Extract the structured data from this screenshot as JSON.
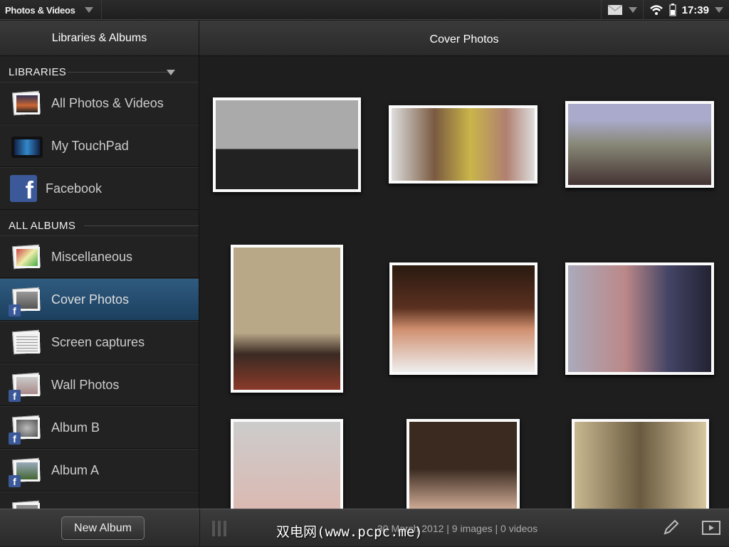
{
  "topbar": {
    "app_menu": "Photos & Videos",
    "clock": "17:39"
  },
  "sidebar": {
    "title": "Libraries & Albums",
    "libraries_header": "LIBRARIES",
    "libraries": [
      {
        "label": "All Photos & Videos"
      },
      {
        "label": "My TouchPad"
      },
      {
        "label": "Facebook"
      }
    ],
    "albums_header": "ALL ALBUMS",
    "albums": [
      {
        "label": "Miscellaneous",
        "facebook": false
      },
      {
        "label": "Cover Photos",
        "facebook": true,
        "selected": true
      },
      {
        "label": "Screen captures",
        "facebook": false
      },
      {
        "label": "Wall Photos",
        "facebook": true
      },
      {
        "label": "Album B",
        "facebook": true
      },
      {
        "label": "Album A",
        "facebook": true
      }
    ],
    "fb_glyph": "f"
  },
  "main": {
    "title": "Cover Photos",
    "photo_count": 9
  },
  "bottom": {
    "new_album": "New Album",
    "info": "30 March 2012 |  9 images |  0 videos",
    "watermark": "双电网(www.pcpc.me)"
  }
}
